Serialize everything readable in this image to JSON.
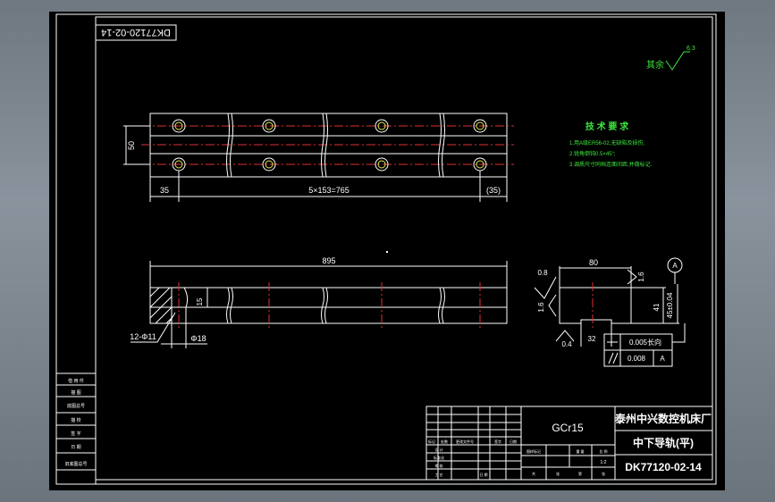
{
  "drawing_id_stamp": "DK77120-02-14",
  "roughness": {
    "symbol_value": "6.3",
    "label": "其余"
  },
  "tech_requirements": {
    "title": "技 术 要 求",
    "items": [
      "1.用A级ER56-02,无缺陷及损伤;",
      "2.锐角倒钝0.5×45°;",
      "3.调质尺寸同档连面间距,并做标记."
    ]
  },
  "top_view": {
    "dim_width": "50",
    "dim_left": "35",
    "dim_pitch": "5×153=765",
    "dim_right": "(35)"
  },
  "front_view": {
    "dim_length": "895",
    "dim_depth": "15",
    "hole_callout": "12-Φ11",
    "counterbore": "Φ18"
  },
  "section_view": {
    "dim_width": "80",
    "dim_height": "41",
    "dim_total": "45±0.04",
    "dim_bottom": "32",
    "rough_a": "0.8",
    "rough_b": "1.6",
    "rough_c": "1.6",
    "rough_d": "0.4",
    "datum": "A",
    "tol1_value": "0.005长向",
    "tol2_value": "0.008",
    "tol2_datum": "A"
  },
  "side_table": [
    "借 用 件",
    "描 图",
    "底图总号",
    "描 校",
    "签 字",
    "日 期",
    "旧底图总号"
  ],
  "title_block": {
    "material": "GCr15",
    "company": "泰州中兴数控机床厂",
    "part_name": "中下导轨(平)",
    "drawing_no": "DK77120-02-14",
    "scale": "1:2",
    "rev_headers": [
      "标记",
      "处数",
      "更改文件号",
      "签字",
      "日期"
    ],
    "small_labels": [
      "设 计",
      "标准化",
      "图样标记",
      "重 量",
      "比 例",
      "审 核",
      "工 艺",
      "日 期",
      "共",
      "张",
      "第",
      "张"
    ]
  }
}
